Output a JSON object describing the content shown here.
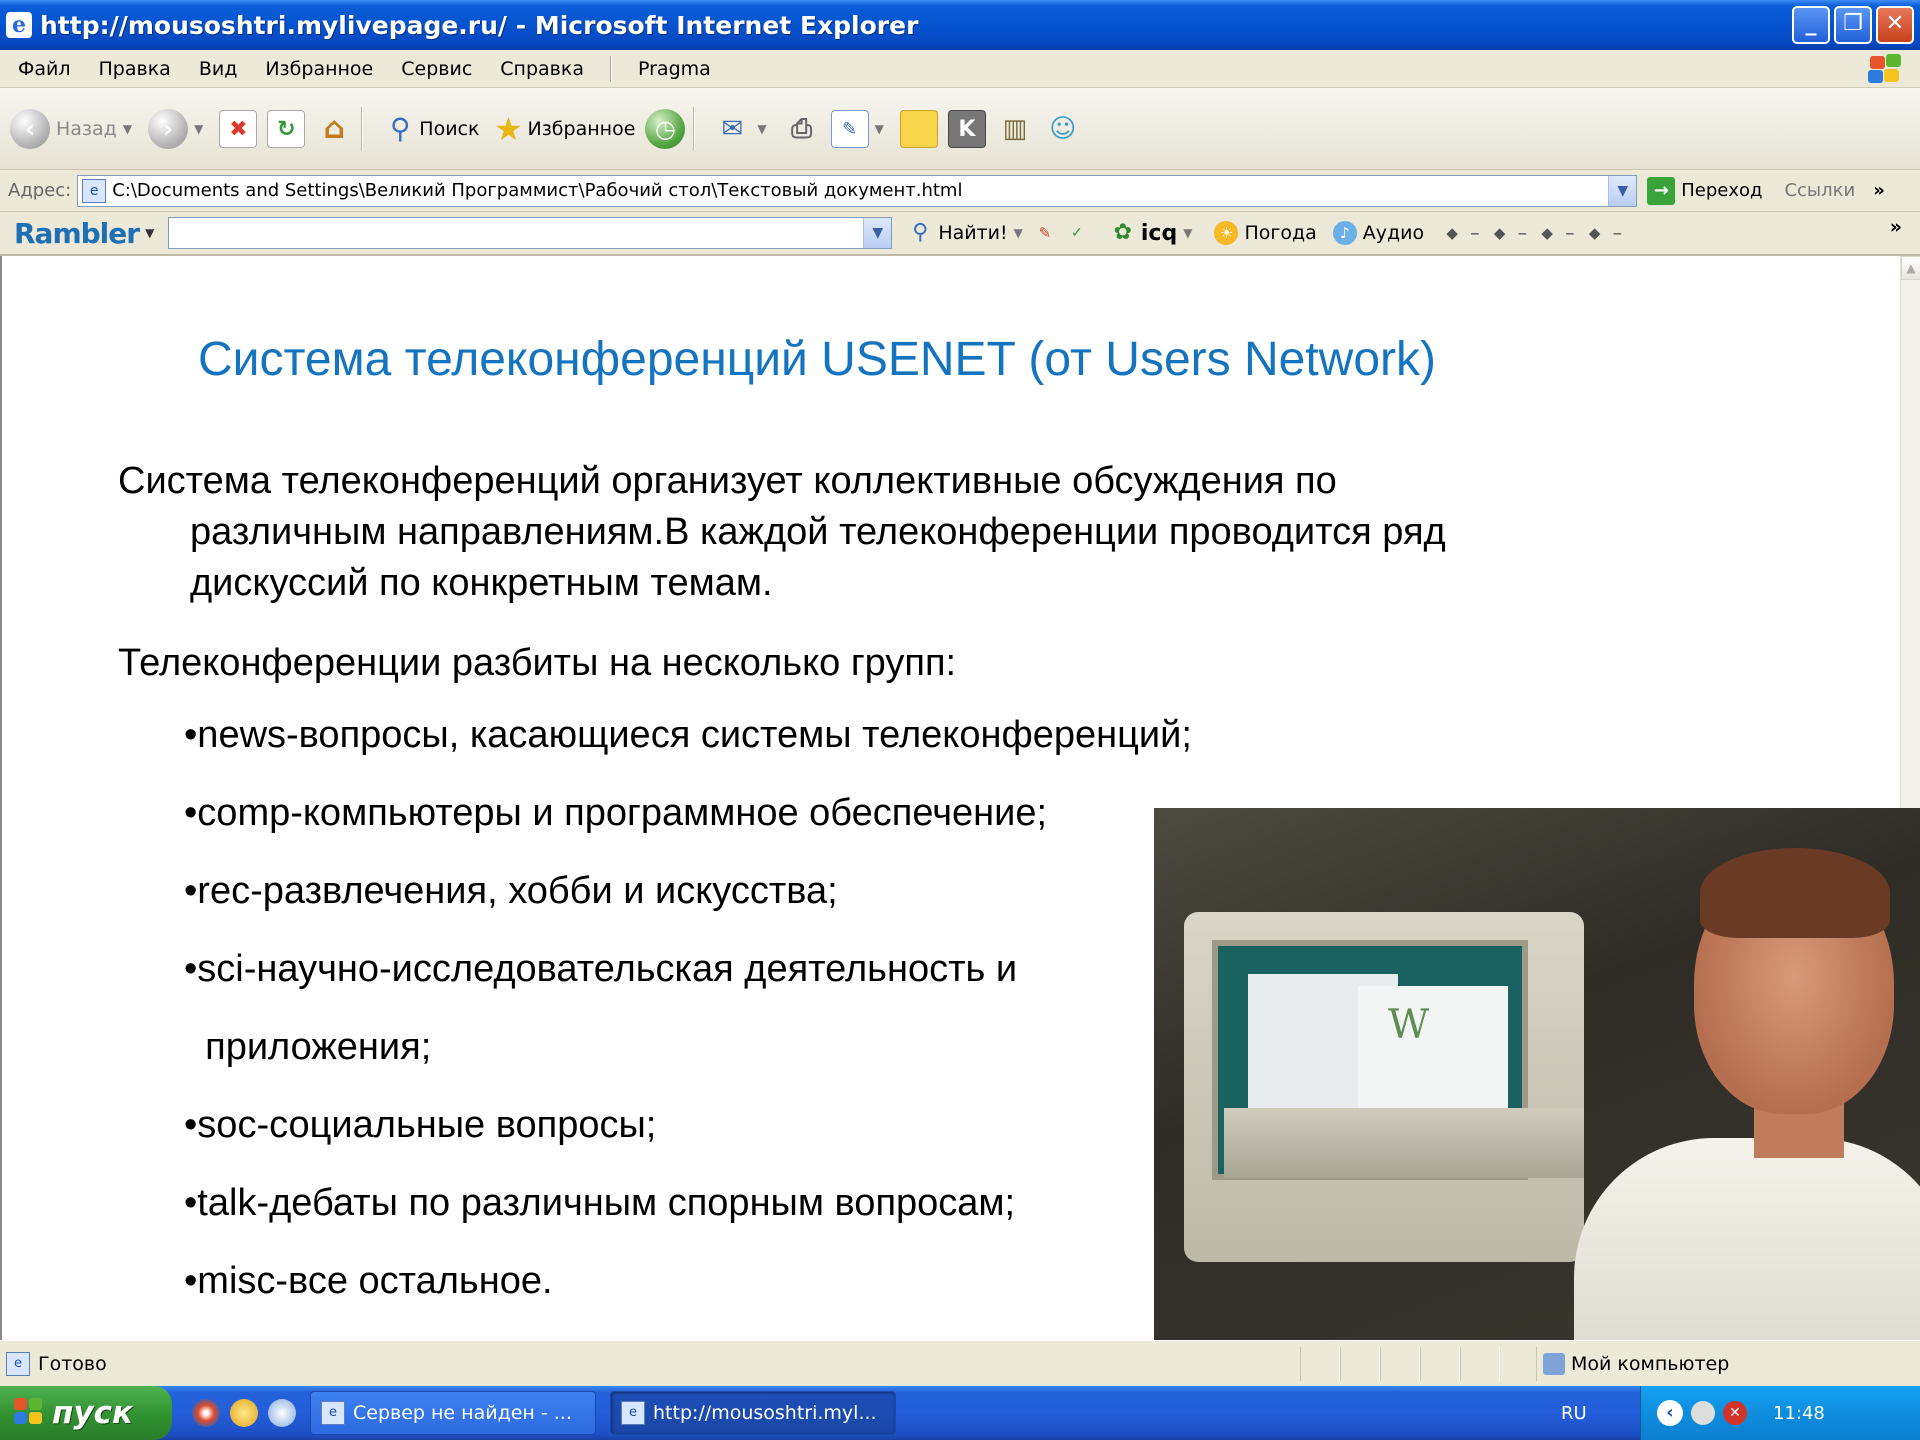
{
  "window": {
    "title": "http://mousoshtri.mylivepage.ru/ - Microsoft Internet Explorer",
    "buttons": [
      "_",
      "❐",
      "✕"
    ]
  },
  "menu": {
    "items": [
      "Файл",
      "Правка",
      "Вид",
      "Избранное",
      "Сервис",
      "Справка"
    ],
    "extra": "Pragma"
  },
  "toolbar": {
    "back": "Назад",
    "search": "Поиск",
    "favorites": "Избранное"
  },
  "address": {
    "label": "Адрес:",
    "value": "C:\\Documents and Settings\\Великий Программист\\Рабочий стол\\Текстовый документ.html",
    "go": "Переход",
    "links": "Ссылки",
    "more": "»"
  },
  "rambler": {
    "logo": "Rambler",
    "find": "Найти!",
    "icq": "icq",
    "weather": "Погода",
    "audio": "Аудио",
    "more": "»"
  },
  "slide": {
    "title": "Система телеконференций USENET (от Users Network)",
    "para1_line1": "Система телеконференций организует коллективные обсуждения по",
    "para1_line2": "различным направлениям.В каждой телеконференции проводится ряд",
    "para1_line3": "дискуссий по конкретным темам.",
    "para2": "Телеконференции разбиты на несколько групп:",
    "bullets": [
      "•news-вопросы, касающиеся системы телеконференций;",
      "•comp-компьютеры и программное обеспечение;",
      "•rec-развлечения, хобби и искусства;",
      "•sci-научно-исследовательская деятельность и",
      "  приложения;",
      "•soc-социальные вопросы;",
      "•talk-дебаты по различным спорным вопросам;",
      "•misc-все остальное."
    ]
  },
  "status": {
    "text": "Готово",
    "zone": "Мой компьютер"
  },
  "taskbar": {
    "start": "пуск",
    "tasks": [
      "Сервер не найден - ...",
      "http://mousoshtri.myl..."
    ],
    "lang": "RU",
    "time": "11:48"
  }
}
